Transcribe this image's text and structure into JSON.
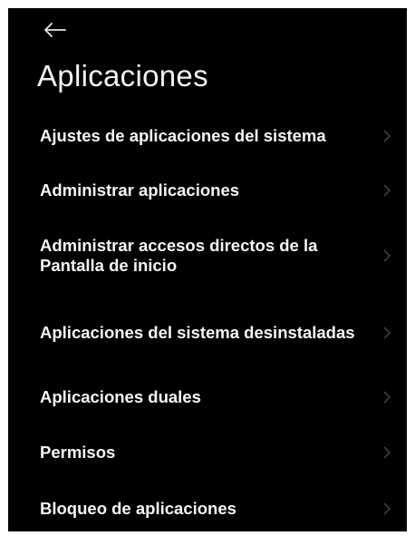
{
  "header": {
    "back_icon": "arrow-left-icon",
    "title": "Aplicaciones"
  },
  "menu": {
    "chevron_icon": "chevron-right-icon",
    "items": [
      {
        "label": "Ajustes de aplicaciones del sistema"
      },
      {
        "label": "Administrar aplicaciones"
      },
      {
        "label": "Administrar accesos directos de la Pantalla de inicio"
      },
      {
        "label": "Aplicaciones del sistema desinstaladas"
      },
      {
        "label": "Aplicaciones duales"
      },
      {
        "label": "Permisos"
      },
      {
        "label": "Bloqueo de aplicaciones"
      }
    ]
  },
  "colors": {
    "background": "#000000",
    "text": "#f5f5f5",
    "chevron": "#4a4a4a"
  }
}
